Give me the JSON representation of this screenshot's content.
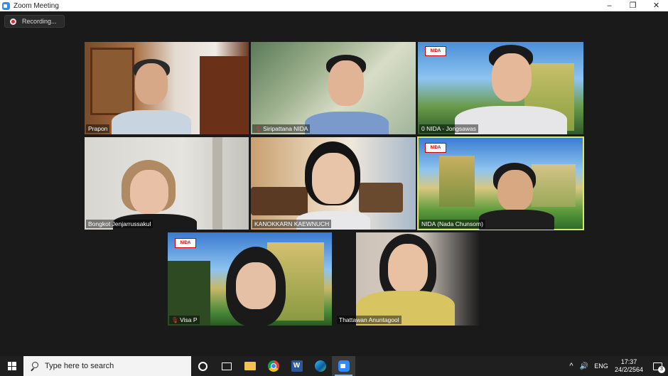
{
  "window": {
    "title": "Zoom Meeting",
    "controls": {
      "minimize": "–",
      "restore": "❐",
      "close": "✕"
    }
  },
  "recording": {
    "label": "Recording..."
  },
  "participants": [
    {
      "name": "Prapon",
      "muted": false
    },
    {
      "name": "Siripattana NIDA",
      "muted": true
    },
    {
      "name": "0 NIDA - Jongsawas",
      "muted": false
    },
    {
      "name": "Bongkot Jenjarrussakul",
      "muted": false
    },
    {
      "name": "KANOKKARN KAEWNUCH",
      "muted": false
    },
    {
      "name": "NIDA (Nada Chunsom)",
      "muted": false,
      "active_speaker": true
    },
    {
      "name": "Visa P",
      "muted": true
    },
    {
      "name": "Thattawan Anuntagool",
      "muted": false
    }
  ],
  "logo_text": "NIDA",
  "colors": {
    "active_speaker_border": "#d4e86a",
    "muted_icon": "#e03c3c",
    "zoom_blue": "#2d8cff"
  },
  "taskbar": {
    "search_placeholder": "Type here to search",
    "apps": [
      "cortana-icon",
      "task-view-icon",
      "file-explorer-icon",
      "chrome-icon",
      "word-icon",
      "edge-icon",
      "zoom-icon"
    ],
    "tray": {
      "caret": "^",
      "speaker": "🔊",
      "language": "ENG",
      "time": "17:37",
      "date": "24/2/2564",
      "notifications": "3"
    }
  }
}
